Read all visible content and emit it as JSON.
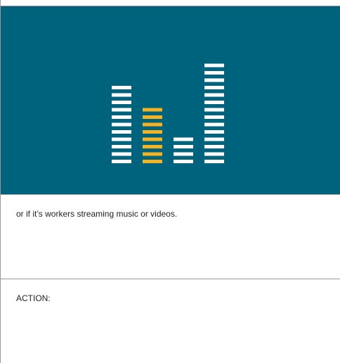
{
  "slide": {
    "colors": {
      "panel_bg": "#00637d",
      "bar_white": "#ffffff",
      "bar_highlight": "#f5b322"
    },
    "graphic": {
      "icon": "audio-equalizer-icon",
      "columns": [
        {
          "segments": 11,
          "highlight": false
        },
        {
          "segments": 8,
          "highlight": true
        },
        {
          "segments": 4,
          "highlight": false
        },
        {
          "segments": 14,
          "highlight": false
        }
      ]
    },
    "caption": "or if it’s workers streaming music or videos.",
    "action_label": "ACTION:"
  }
}
